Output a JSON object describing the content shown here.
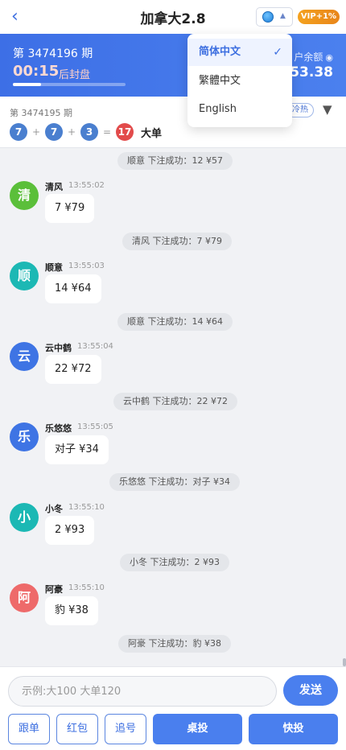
{
  "header": {
    "title": "加拿大2.8",
    "back_icon": "chevron-left-icon",
    "lang_icon": "globe-icon",
    "vip": "VIP+1%"
  },
  "banner": {
    "period": "第 3474196 期",
    "countdown": "00:15",
    "countdown_label": "后封盘",
    "progress": 0.25,
    "balance_label": "户余额",
    "balance_value": "653.38"
  },
  "result": {
    "period": "第 3474195 期",
    "balls": [
      "7",
      "7",
      "3"
    ],
    "ops": [
      "+",
      "+",
      "="
    ],
    "sum": "17",
    "text": "大单",
    "hot_tag": "冷热"
  },
  "language_menu": {
    "items": [
      {
        "label": "简体中文",
        "selected": true
      },
      {
        "label": "繁體中文",
        "selected": false
      },
      {
        "label": "English",
        "selected": false
      }
    ],
    "check": "✓"
  },
  "chat": {
    "system_top": "顺意 下注成功：12 ¥57",
    "messages": [
      {
        "avatar": "清",
        "color": "#5bbf3a",
        "name": "清风",
        "time": "13:55:02",
        "text": "7 ¥79",
        "confirm": "清风 下注成功：7 ¥79"
      },
      {
        "avatar": "顺",
        "color": "#1cb8b4",
        "name": "顺意",
        "time": "13:55:03",
        "text": "14 ¥64",
        "confirm": "顺意 下注成功：14 ¥64"
      },
      {
        "avatar": "云",
        "color": "#3e74e4",
        "name": "云中鹤",
        "time": "13:55:04",
        "text": "22 ¥72",
        "confirm": "云中鹤 下注成功：22 ¥72"
      },
      {
        "avatar": "乐",
        "color": "#3e74e4",
        "name": "乐悠悠",
        "time": "13:55:05",
        "text": "对子 ¥34",
        "confirm": "乐悠悠 下注成功：对子 ¥34"
      },
      {
        "avatar": "小",
        "color": "#1cb8b4",
        "name": "小冬",
        "time": "13:55:10",
        "text": "2 ¥93",
        "confirm": "小冬 下注成功：2 ¥93"
      },
      {
        "avatar": "阿",
        "color": "#ee6a6a",
        "name": "阿豪",
        "time": "13:55:10",
        "text": "豹 ¥38",
        "confirm": "阿豪 下注成功：豹 ¥38"
      }
    ]
  },
  "input": {
    "placeholder": "示例:大100 大单120",
    "send_label": "发送"
  },
  "actions": {
    "follow": "跟单",
    "redpacket": "红包",
    "chase": "追号",
    "table_bet": "桌投",
    "quick_bet": "快投"
  },
  "colors": {
    "primary": "#4a7fee",
    "vip": "#f09a1d",
    "result_red": "#e24b4b",
    "ball_blue": "#4a7fcf"
  }
}
